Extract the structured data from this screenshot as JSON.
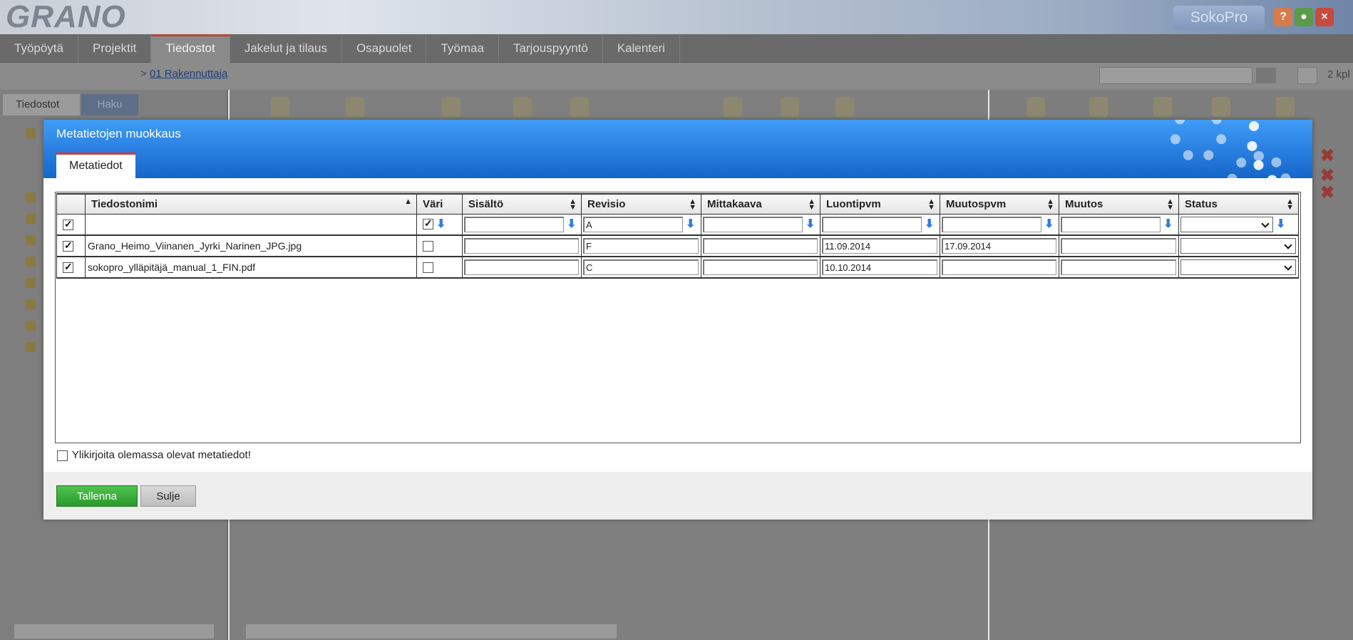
{
  "app": {
    "logo": "GRANO",
    "product": "SokoPro",
    "header_buttons": [
      "?",
      "person-icon",
      "×"
    ]
  },
  "nav": {
    "tabs": [
      "Työpöytä",
      "Projektit",
      "Tiedostot",
      "Jakelut ja tilaus",
      "Osapuolet",
      "Työmaa",
      "Tarjouspyyntö",
      "Kalenteri"
    ],
    "active": "Tiedostot"
  },
  "breadcrumb": {
    "prefix": ">",
    "link": "01 Rakennuttaja"
  },
  "cart": {
    "count": "2 kpl"
  },
  "left_tabs": {
    "files": "Tiedostot",
    "search": "Haku"
  },
  "dialog": {
    "title": "Metatietojen muokkaus",
    "tab": "Metatiedot",
    "columns": [
      "Tiedostonimi",
      "Väri",
      "Sisältö",
      "Revisio",
      "Mittakaava",
      "Luontipvm",
      "Muutospvm",
      "Muutos",
      "Status"
    ],
    "filter_row": {
      "checked": true,
      "color_checked": true,
      "revisio": "A"
    },
    "rows": [
      {
        "checked": true,
        "name": "Grano_Heimo_Viinanen_Jyrki_Narinen_JPG.jpg",
        "color": false,
        "sisalto": "",
        "revisio": "F",
        "mittakaava": "",
        "luontipvm": "11.09.2014",
        "muutospvm": "17.09.2014",
        "muutos": "",
        "status": ""
      },
      {
        "checked": true,
        "name": "sokopro_ylläpitäjä_manual_1_FIN.pdf",
        "color": false,
        "sisalto": "",
        "revisio": "C",
        "mittakaava": "",
        "luontipvm": "10.10.2014",
        "muutospvm": "",
        "muutos": "",
        "status": ""
      }
    ],
    "overwrite_label": "Ylikirjoita olemassa olevat metatiedot!",
    "save_label": "Tallenna",
    "close_label": "Sulje"
  },
  "colors": {
    "dialog_header": "#2f86e6",
    "save_button": "#3aa83a",
    "active_tab_accent": "#d13a3a"
  }
}
